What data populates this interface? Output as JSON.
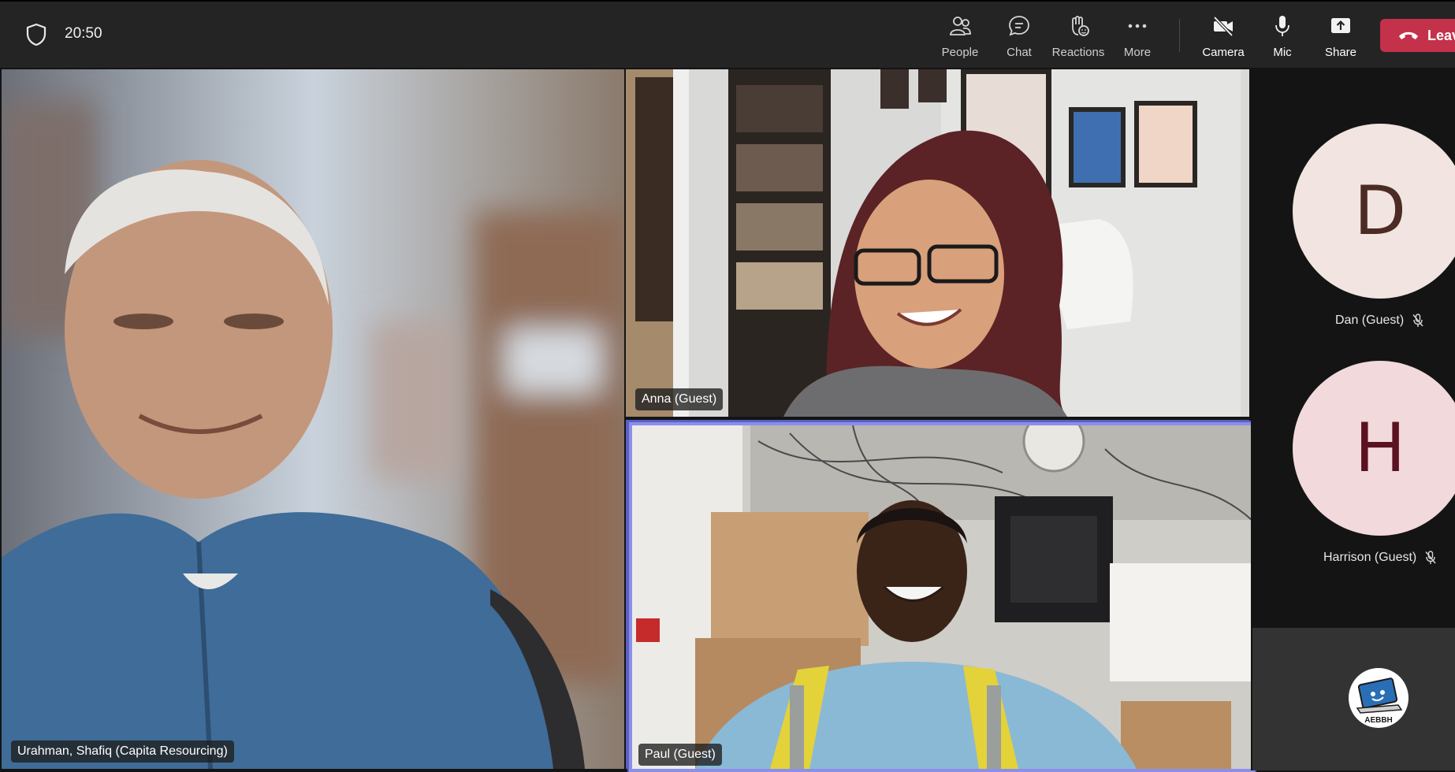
{
  "topbar": {
    "time": "20:50",
    "buttons": {
      "people": "People",
      "chat": "Chat",
      "reactions": "Reactions",
      "more": "More",
      "camera": "Camera",
      "mic": "Mic",
      "share": "Share",
      "leave": "Leav"
    }
  },
  "tiles": {
    "left": {
      "name": "Urahman, Shafiq (Capita Resourcing)"
    },
    "top_right": {
      "name": "Anna (Guest)"
    },
    "bottom_right": {
      "name": "Paul (Guest)"
    }
  },
  "side_panel": {
    "participants": [
      {
        "initial": "D",
        "name": "Dan (Guest)",
        "muted": true,
        "avatar_bg": "#f1e4e1",
        "initial_color": "#4b2b24"
      },
      {
        "initial": "H",
        "name": "Harrison (Guest)",
        "muted": true,
        "avatar_bg": "#f2d9dc",
        "initial_color": "#5a1220"
      }
    ],
    "self_logo_text": "AEBBH"
  },
  "colors": {
    "leave": "#c4314b",
    "active_speaker_border": "#8b8fe8",
    "topbar_bg": "#242424"
  }
}
